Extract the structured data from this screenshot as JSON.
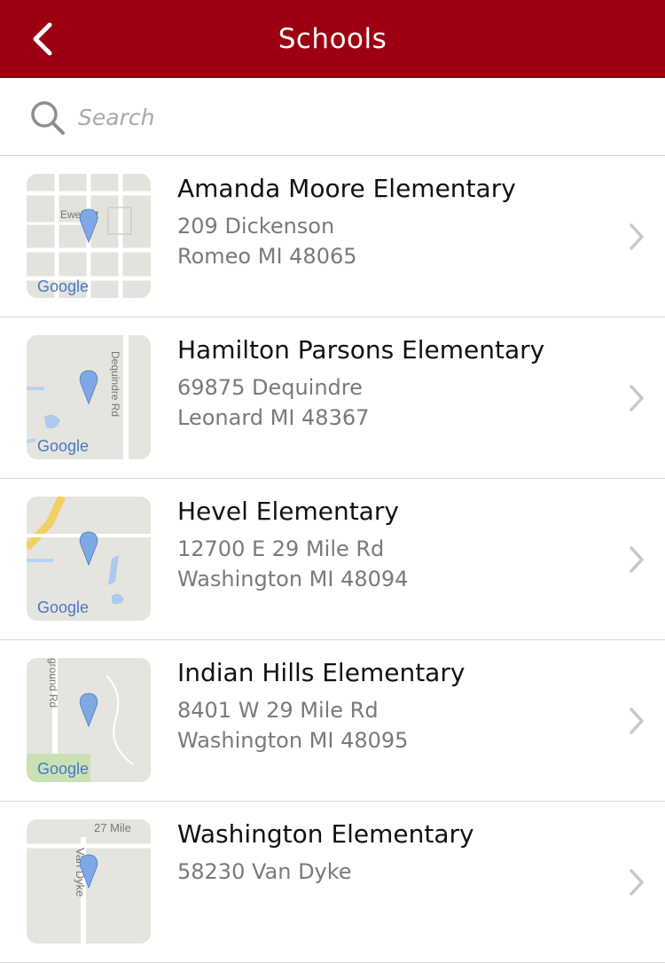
{
  "header": {
    "title": "Schools",
    "back_icon": "chevron-left-icon",
    "color": "#9c0010"
  },
  "search": {
    "placeholder": "Search",
    "value": "",
    "icon": "search-icon"
  },
  "map_label": "Google",
  "schools": [
    {
      "name": "Amanda Moore Elementary",
      "address1": "209 Dickenson",
      "address2": "Romeo MI 48065",
      "map_street": "Ewell St"
    },
    {
      "name": "Hamilton Parsons Elementary",
      "address1": "69875 Dequindre",
      "address2": "Leonard MI 48367",
      "map_street": "Dequindre Rd"
    },
    {
      "name": "Hevel Elementary",
      "address1": "12700 E 29 Mile Rd",
      "address2": "Washington MI 48094",
      "map_street": ""
    },
    {
      "name": "Indian Hills Elementary",
      "address1": "8401 W 29 Mile Rd",
      "address2": "Washington MI 48095",
      "map_street": "ground Rd"
    },
    {
      "name": "Washington Elementary",
      "address1": "58230 Van Dyke",
      "address2": "",
      "map_street": "27 Mile"
    }
  ]
}
